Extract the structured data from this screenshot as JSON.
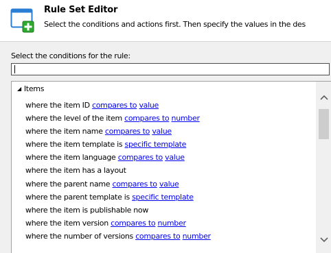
{
  "header": {
    "title": "Rule Set Editor",
    "subtitle": "Select the conditions and actions first. Then specify the values in the des",
    "icon": "rule-editor-add-icon"
  },
  "conditions": {
    "label": "Select the conditions for the rule:",
    "search_value": ""
  },
  "tree": {
    "root_label": "Items",
    "root_arrow": "◢",
    "rules": [
      {
        "text": "where the item ID ",
        "links": [
          "compares to",
          "value"
        ]
      },
      {
        "text": "where the level of the item ",
        "links": [
          "compares to",
          "number"
        ]
      },
      {
        "text": "where the item name ",
        "links": [
          "compares to",
          "value"
        ]
      },
      {
        "text": "where the item template is ",
        "links": [
          "specific template"
        ]
      },
      {
        "text": "where the item language ",
        "links": [
          "compares to",
          "value"
        ]
      },
      {
        "text": "where the item has a layout",
        "links": []
      },
      {
        "text": "where the parent name ",
        "links": [
          "compares to",
          "value"
        ]
      },
      {
        "text": "where the parent template is ",
        "links": [
          "specific template"
        ]
      },
      {
        "text": "where the item is publishable now",
        "links": []
      },
      {
        "text": "where the item version ",
        "links": [
          "compares to",
          "number"
        ]
      },
      {
        "text": "where the number of versions ",
        "links": [
          "compares to",
          "number"
        ]
      }
    ]
  },
  "colors": {
    "link": "#0000ee",
    "accent": "#2a7fd4",
    "add_green": "#2fa82f"
  }
}
